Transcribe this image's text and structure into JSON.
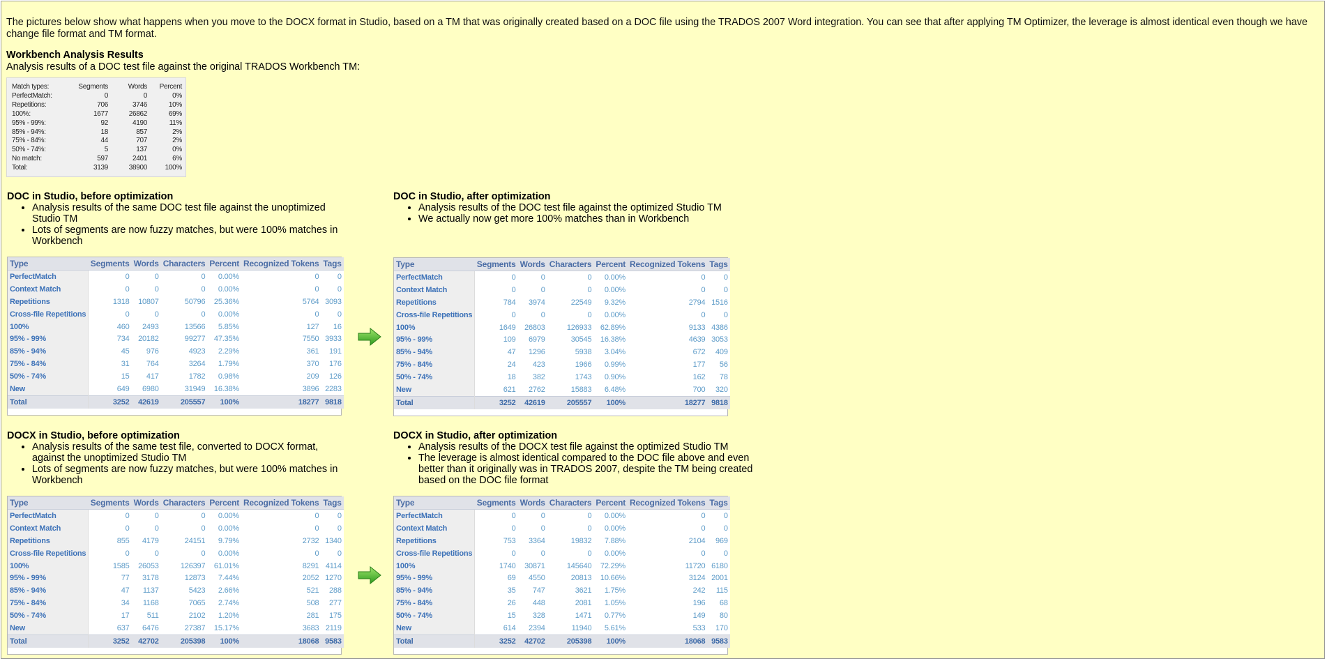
{
  "intro": "The pictures below show what happens when you move to the DOCX format in Studio, based on a TM that was originally created based on a DOC file using the TRADOS 2007 Word integration. You can see that after applying TM Optimizer, the leverage is almost identical even though we have change file format and TM format.",
  "workbench": {
    "heading": "Workbench Analysis Results",
    "caption": "Analysis results of a DOC test file against the original TRADOS Workbench TM:",
    "headers": [
      "Match types:",
      "Segments",
      "Words",
      "Percent"
    ],
    "rows": [
      [
        "PerfectMatch:",
        "0",
        "0",
        "0%"
      ],
      [
        "Repetitions:",
        "706",
        "3746",
        "10%"
      ],
      [
        "100%:",
        "1677",
        "26862",
        "69%"
      ],
      [
        "95% - 99%:",
        "92",
        "4190",
        "11%"
      ],
      [
        "85% - 94%:",
        "18",
        "857",
        "2%"
      ],
      [
        "75% - 84%:",
        "44",
        "707",
        "2%"
      ],
      [
        "50% - 74%:",
        "5",
        "137",
        "0%"
      ],
      [
        "No match:",
        "597",
        "2401",
        "6%"
      ]
    ],
    "total": [
      "Total:",
      "3139",
      "38900",
      "100%"
    ]
  },
  "sections": {
    "doc_before": {
      "heading": "DOC in Studio, before optimization",
      "bullets": [
        "Analysis results of the same DOC test file against the unoptimized Studio TM",
        "Lots of segments are now fuzzy matches, but were 100% matches in Workbench"
      ]
    },
    "doc_after": {
      "heading": "DOC in Studio, after optimization",
      "bullets": [
        "Analysis results of the DOC test file against the optimized Studio TM",
        "We actually now get more 100% matches than in Workbench"
      ]
    },
    "docx_before": {
      "heading": "DOCX in Studio, before optimization",
      "bullets": [
        "Analysis results of the same test file, converted to DOCX format, against the unoptimized Studio TM",
        "Lots of segments are now fuzzy matches, but were 100% matches in Workbench"
      ]
    },
    "docx_after": {
      "heading": "DOCX in Studio, after optimization",
      "bullets": [
        "Analysis results of the DOCX test file against the optimized Studio TM",
        "The leverage is almost identical compared to the DOC file above and even better than it originally was in TRADOS 2007, despite the TM being created based on the DOC file format"
      ]
    }
  },
  "studio_headers": [
    "Type",
    "Segments",
    "Words",
    "Characters",
    "Percent",
    "Recognized Tokens",
    "Tags"
  ],
  "tables": {
    "doc_before": [
      [
        "PerfectMatch",
        "0",
        "0",
        "0",
        "0.00%",
        "0",
        "0"
      ],
      [
        "Context Match",
        "0",
        "0",
        "0",
        "0.00%",
        "0",
        "0"
      ],
      [
        "Repetitions",
        "1318",
        "10807",
        "50796",
        "25.36%",
        "5764",
        "3093"
      ],
      [
        "Cross-file Repetitions",
        "0",
        "0",
        "0",
        "0.00%",
        "0",
        "0"
      ],
      [
        "100%",
        "460",
        "2493",
        "13566",
        "5.85%",
        "127",
        "16"
      ],
      [
        "95% - 99%",
        "734",
        "20182",
        "99277",
        "47.35%",
        "7550",
        "3933"
      ],
      [
        "85% - 94%",
        "45",
        "976",
        "4923",
        "2.29%",
        "361",
        "191"
      ],
      [
        "75% - 84%",
        "31",
        "764",
        "3264",
        "1.79%",
        "370",
        "176"
      ],
      [
        "50% - 74%",
        "15",
        "417",
        "1782",
        "0.98%",
        "209",
        "126"
      ],
      [
        "New",
        "649",
        "6980",
        "31949",
        "16.38%",
        "3896",
        "2283"
      ],
      [
        "Total",
        "3252",
        "42619",
        "205557",
        "100%",
        "18277",
        "9818"
      ]
    ],
    "doc_after": [
      [
        "PerfectMatch",
        "0",
        "0",
        "0",
        "0.00%",
        "0",
        "0"
      ],
      [
        "Context Match",
        "0",
        "0",
        "0",
        "0.00%",
        "0",
        "0"
      ],
      [
        "Repetitions",
        "784",
        "3974",
        "22549",
        "9.32%",
        "2794",
        "1516"
      ],
      [
        "Cross-file Repetitions",
        "0",
        "0",
        "0",
        "0.00%",
        "0",
        "0"
      ],
      [
        "100%",
        "1649",
        "26803",
        "126933",
        "62.89%",
        "9133",
        "4386"
      ],
      [
        "95% - 99%",
        "109",
        "6979",
        "30545",
        "16.38%",
        "4639",
        "3053"
      ],
      [
        "85% - 94%",
        "47",
        "1296",
        "5938",
        "3.04%",
        "672",
        "409"
      ],
      [
        "75% - 84%",
        "24",
        "423",
        "1966",
        "0.99%",
        "177",
        "56"
      ],
      [
        "50% - 74%",
        "18",
        "382",
        "1743",
        "0.90%",
        "162",
        "78"
      ],
      [
        "New",
        "621",
        "2762",
        "15883",
        "6.48%",
        "700",
        "320"
      ],
      [
        "Total",
        "3252",
        "42619",
        "205557",
        "100%",
        "18277",
        "9818"
      ]
    ],
    "docx_before": [
      [
        "PerfectMatch",
        "0",
        "0",
        "0",
        "0.00%",
        "0",
        "0"
      ],
      [
        "Context Match",
        "0",
        "0",
        "0",
        "0.00%",
        "0",
        "0"
      ],
      [
        "Repetitions",
        "855",
        "4179",
        "24151",
        "9.79%",
        "2732",
        "1340"
      ],
      [
        "Cross-file Repetitions",
        "0",
        "0",
        "0",
        "0.00%",
        "0",
        "0"
      ],
      [
        "100%",
        "1585",
        "26053",
        "126397",
        "61.01%",
        "8291",
        "4114"
      ],
      [
        "95% - 99%",
        "77",
        "3178",
        "12873",
        "7.44%",
        "2052",
        "1270"
      ],
      [
        "85% - 94%",
        "47",
        "1137",
        "5423",
        "2.66%",
        "521",
        "288"
      ],
      [
        "75% - 84%",
        "34",
        "1168",
        "7065",
        "2.74%",
        "508",
        "277"
      ],
      [
        "50% - 74%",
        "17",
        "511",
        "2102",
        "1.20%",
        "281",
        "175"
      ],
      [
        "New",
        "637",
        "6476",
        "27387",
        "15.17%",
        "3683",
        "2119"
      ],
      [
        "Total",
        "3252",
        "42702",
        "205398",
        "100%",
        "18068",
        "9583"
      ]
    ],
    "docx_after": [
      [
        "PerfectMatch",
        "0",
        "0",
        "0",
        "0.00%",
        "0",
        "0"
      ],
      [
        "Context Match",
        "0",
        "0",
        "0",
        "0.00%",
        "0",
        "0"
      ],
      [
        "Repetitions",
        "753",
        "3364",
        "19832",
        "7.88%",
        "2104",
        "969"
      ],
      [
        "Cross-file Repetitions",
        "0",
        "0",
        "0",
        "0.00%",
        "0",
        "0"
      ],
      [
        "100%",
        "1740",
        "30871",
        "145640",
        "72.29%",
        "11720",
        "6180"
      ],
      [
        "95% - 99%",
        "69",
        "4550",
        "20813",
        "10.66%",
        "3124",
        "2001"
      ],
      [
        "85% - 94%",
        "35",
        "747",
        "3621",
        "1.75%",
        "242",
        "115"
      ],
      [
        "75% - 84%",
        "26",
        "448",
        "2081",
        "1.05%",
        "196",
        "68"
      ],
      [
        "50% - 74%",
        "15",
        "328",
        "1471",
        "0.77%",
        "149",
        "80"
      ],
      [
        "New",
        "614",
        "2394",
        "11940",
        "5.61%",
        "533",
        "170"
      ],
      [
        "Total",
        "3252",
        "42702",
        "205398",
        "100%",
        "18068",
        "9583"
      ]
    ]
  },
  "arrow_icon": "green-right-arrow-icon"
}
